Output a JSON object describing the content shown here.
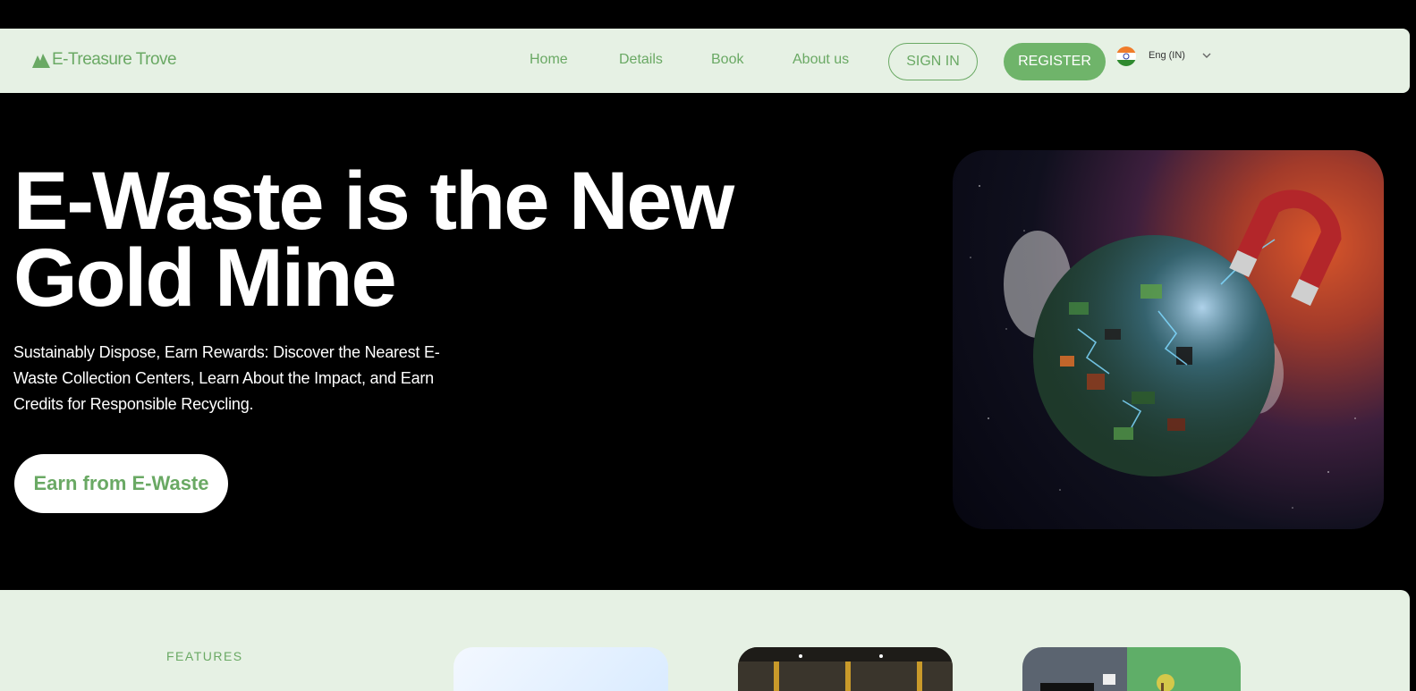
{
  "nav": {
    "logo_text": "E-Treasure Trove",
    "logo_icon": "mountain-icon",
    "links": [
      "Home",
      "Details",
      "Book",
      "About us"
    ],
    "sign_in": "SIGN IN",
    "register": "REGISTER",
    "language": "Eng (IN)",
    "flag_icon": "india-flag-icon"
  },
  "hero": {
    "title": "E-Waste is the New Gold Mine",
    "subtitle": "Sustainably Dispose, Earn Rewards: Discover the Nearest E-Waste Collection Centers, Learn About the Impact, and Earn Credits for Responsible Recycling.",
    "cta": "Earn from E-Waste"
  },
  "features": {
    "label": "FEATURES"
  },
  "colors": {
    "accent_green": "#6aa964",
    "nav_bg": "#e6f1e4",
    "register_bg": "#6fb46a",
    "page_bg": "#000000"
  }
}
